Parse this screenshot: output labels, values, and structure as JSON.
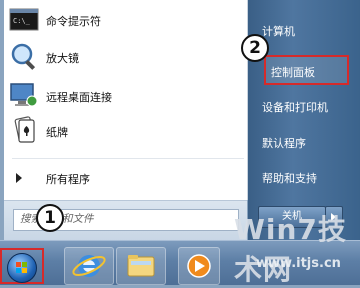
{
  "start_menu": {
    "pinned_items": [
      {
        "label": "命令提示符",
        "icon": "command-prompt-icon"
      },
      {
        "label": "放大镜",
        "icon": "magnifier-icon"
      },
      {
        "label": "远程桌面连接",
        "icon": "remote-desktop-icon"
      },
      {
        "label": "纸牌",
        "icon": "solitaire-icon"
      }
    ],
    "all_programs_label": "所有程序",
    "search_placeholder": "搜索程序和文件",
    "right_items": [
      {
        "label": "计算机"
      },
      {
        "label": "控制面板"
      },
      {
        "label": "设备和打印机"
      },
      {
        "label": "默认程序"
      },
      {
        "label": "帮助和支持"
      }
    ],
    "shutdown_label": "关机"
  },
  "annotations": {
    "badge_1": "1",
    "badge_2": "2",
    "highlight_color": "#d62a2a"
  },
  "taskbar": {
    "items": [
      "start-orb",
      "internet-explorer-icon",
      "file-explorer-icon",
      "media-player-icon"
    ]
  },
  "watermark": {
    "logo_text": "Win7技术网",
    "url": "www.itjs.cn"
  }
}
